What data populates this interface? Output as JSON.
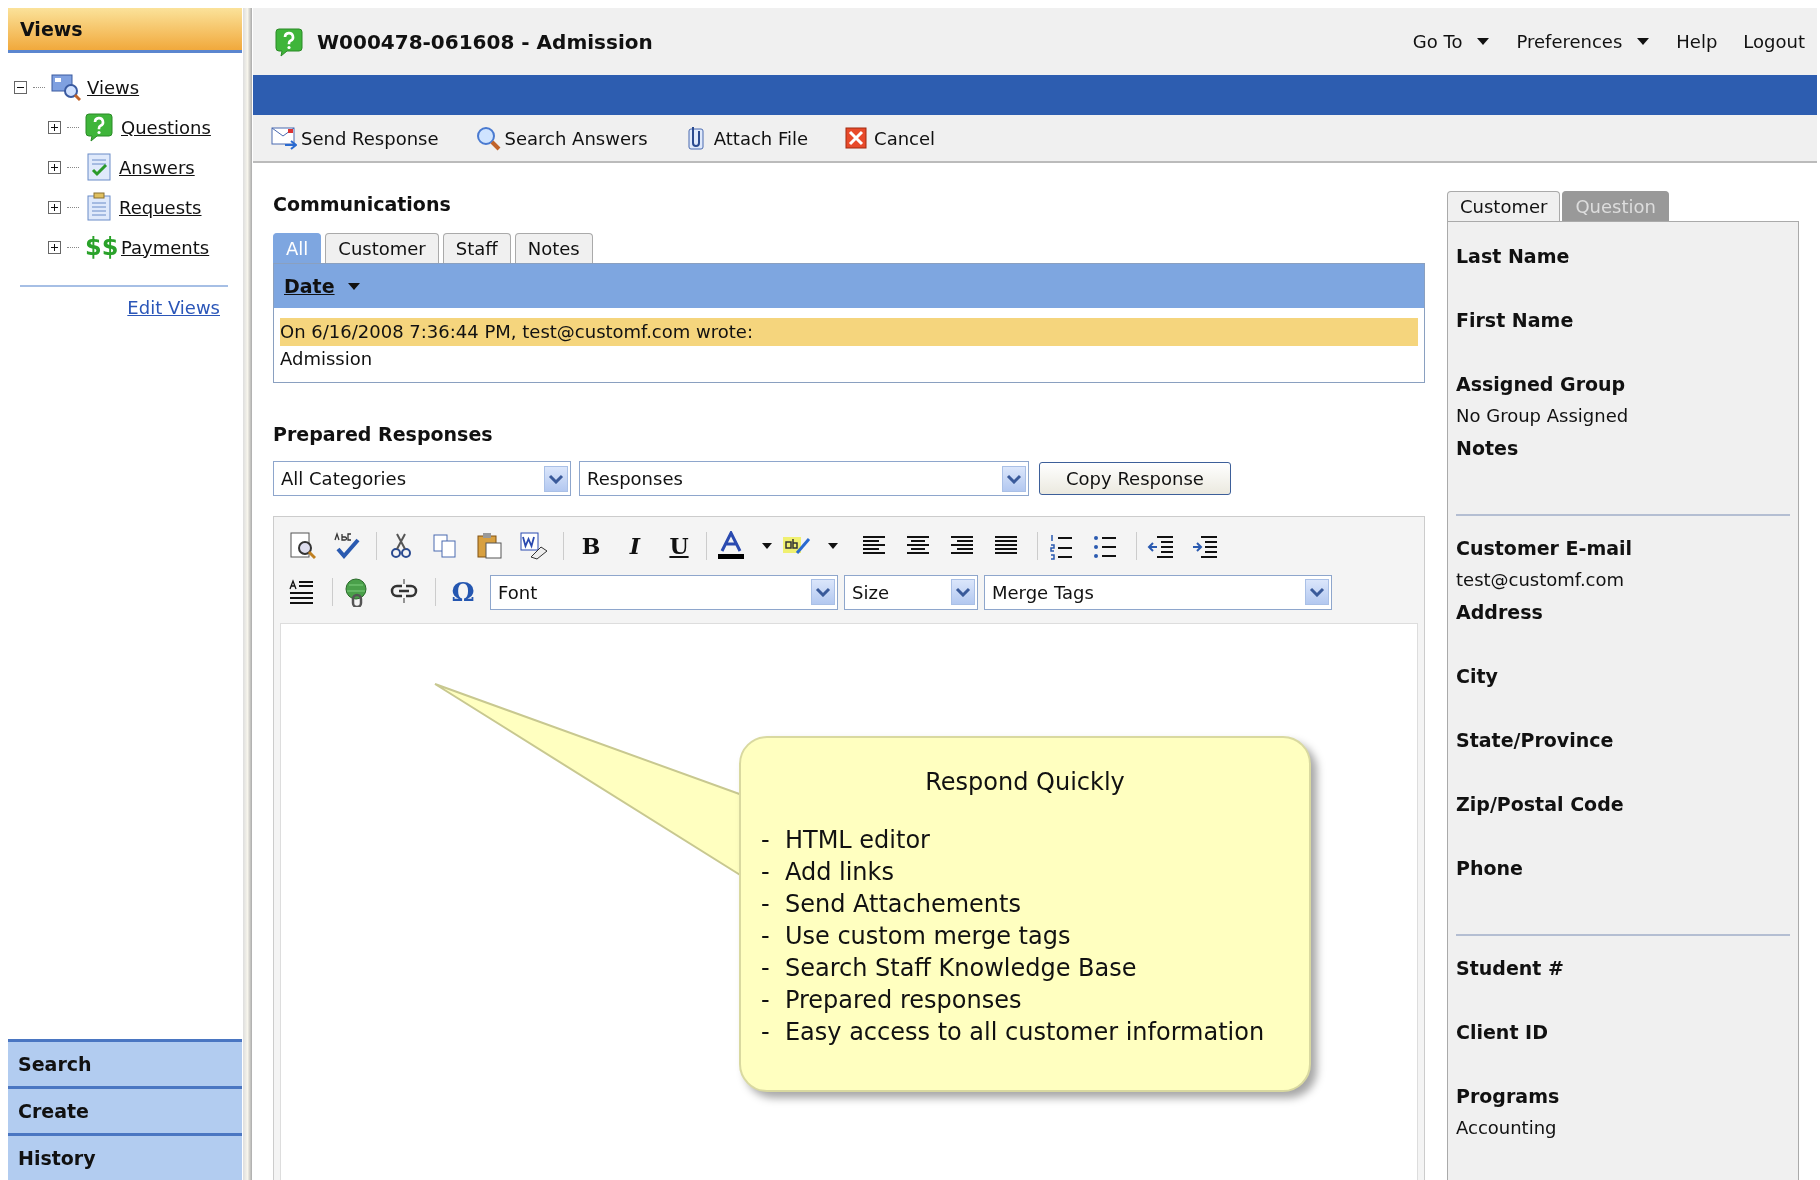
{
  "sidebar": {
    "header": "Views",
    "tree": [
      {
        "label": "Views",
        "expanded": true,
        "children": [
          {
            "label": "Questions",
            "expanded": false
          },
          {
            "label": "Answers",
            "expanded": false
          },
          {
            "label": "Requests",
            "expanded": false
          },
          {
            "label": "Payments",
            "icon_text": "$$",
            "expanded": false
          }
        ]
      }
    ],
    "edit_link": "Edit Views",
    "sections": [
      "Search",
      "Create",
      "History"
    ]
  },
  "header": {
    "title": "W000478-061608 - Admission",
    "nav": [
      {
        "label": "Go To",
        "dropdown": true
      },
      {
        "label": "Preferences",
        "dropdown": true
      },
      {
        "label": "Help",
        "dropdown": false
      },
      {
        "label": "Logout",
        "dropdown": false
      }
    ]
  },
  "toolbar": [
    {
      "kind": "send",
      "label": "Send Response"
    },
    {
      "kind": "search",
      "label": "Search Answers"
    },
    {
      "kind": "attach",
      "label": "Attach File"
    },
    {
      "kind": "cancel",
      "label": "Cancel"
    }
  ],
  "communications": {
    "title": "Communications",
    "tabs": [
      {
        "label": "All",
        "selected": true
      },
      {
        "label": "Customer",
        "selected": false
      },
      {
        "label": "Staff",
        "selected": false
      },
      {
        "label": "Notes",
        "selected": false
      }
    ],
    "sort_column": "Date",
    "messages": [
      {
        "header": "On 6/16/2008 7:36:44 PM, test@customf.com wrote:",
        "body": "Admission",
        "highlighted": true
      }
    ]
  },
  "prepared_responses": {
    "title": "Prepared Responses",
    "category": "All Categories",
    "response": "Responses",
    "copy_button": "Copy Response"
  },
  "editor": {
    "format_buttons": [
      "B",
      "I",
      "U"
    ],
    "symbol_button": "Ω",
    "font": "Font",
    "size": "Size",
    "merge_tags": "Merge Tags"
  },
  "callout": {
    "title": "Respond Quickly",
    "items": [
      "-  HTML editor",
      "-  Add links",
      "-  Send Attachements",
      "-  Use custom merge tags",
      "-  Search Staff Knowledge Base",
      "-  Prepared responses",
      "-  Easy access to all customer information"
    ]
  },
  "details": {
    "tabs": [
      {
        "label": "Customer",
        "selected": true
      },
      {
        "label": "Question",
        "selected": false
      }
    ],
    "groups": [
      [
        {
          "label": "Last Name"
        },
        {
          "label": "First Name"
        },
        {
          "label": "Assigned Group",
          "value": "No Group Assigned"
        },
        {
          "label": "Notes"
        }
      ],
      [
        {
          "label": "Customer E-mail",
          "value": "test@customf.com"
        },
        {
          "label": "Address"
        },
        {
          "label": "City"
        },
        {
          "label": "State/Province"
        },
        {
          "label": "Zip/Postal Code"
        },
        {
          "label": "Phone"
        }
      ],
      [
        {
          "label": "Student #"
        },
        {
          "label": "Client ID"
        },
        {
          "label": "Programs",
          "value": "Accounting"
        }
      ]
    ]
  }
}
